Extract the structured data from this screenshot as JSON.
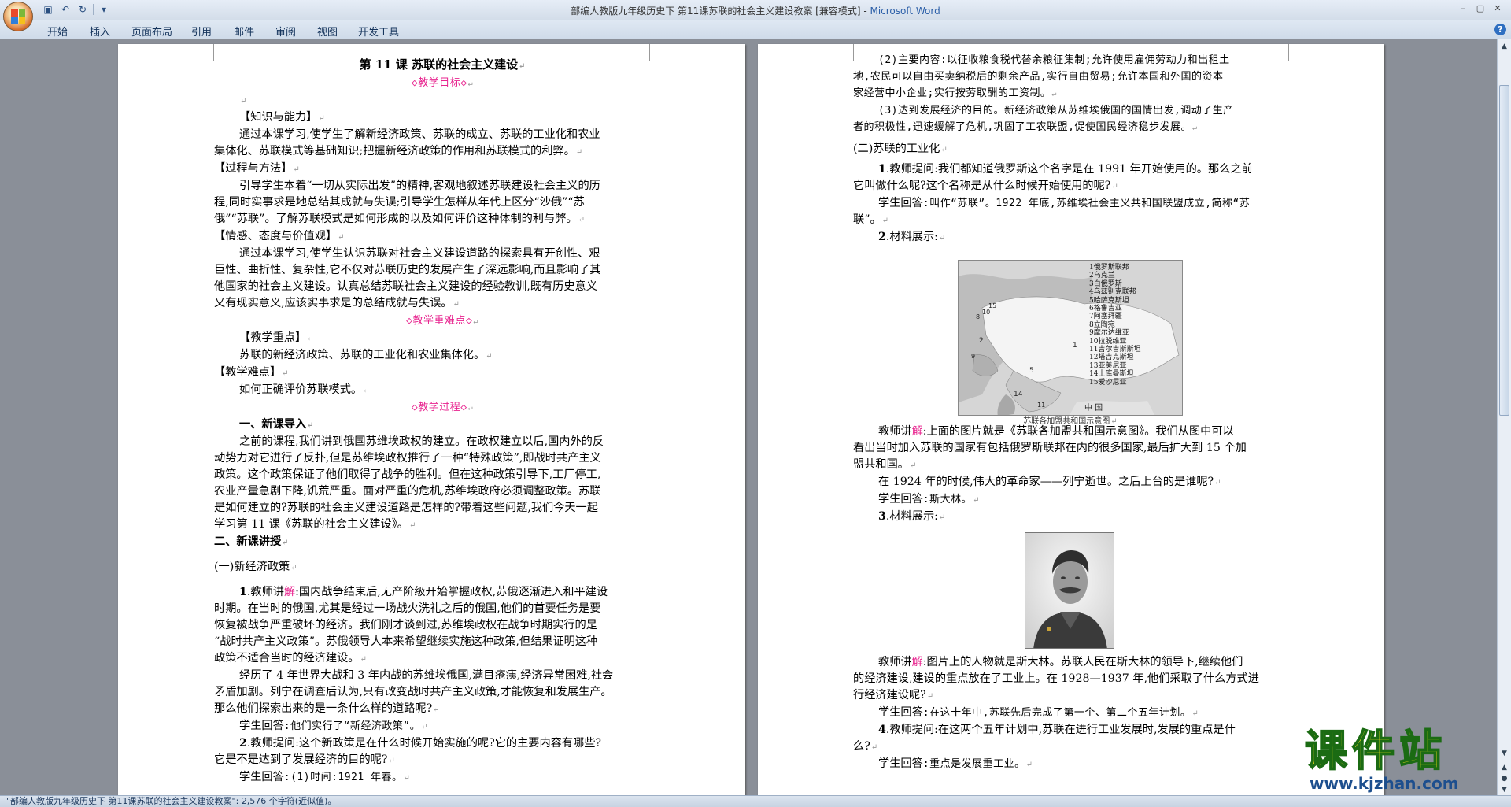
{
  "window": {
    "title": "部编人教版九年级历史下  第11课苏联的社会主义建设教案 [兼容模式] - ",
    "app_name": "Microsoft Word",
    "controls": [
      "–",
      "▢",
      "✕"
    ]
  },
  "ribbon": {
    "tabs": [
      "开始",
      "插入",
      "页面布局",
      "引用",
      "邮件",
      "审阅",
      "视图",
      "开发工具"
    ]
  },
  "page1": {
    "title": "第 11 课    苏联的社会主义建设",
    "sec_goal": "◇教学目标◇",
    "p_kn_head": "【知识与能力】",
    "p_kn_1": "通过本课学习,使学生了解新经济政策、苏联的成立、苏联的工业化和农业",
    "p_kn_2": "集体化、苏联模式等基础知识;把握新经济政策的作用和苏联模式的利弊。",
    "p_pr_head": "【过程与方法】",
    "p_pr_1": "引导学生本着“一切从实际出发”的精神,客观地叙述苏联建设社会主义的历",
    "p_pr_2": "程,同时实事求是地总结其成就与失误;引导学生怎样从年代上区分“沙俄”“苏",
    "p_pr_3": "俄”“苏联”。了解苏联模式是如何形成的以及如何评价这种体制的利与弊。",
    "p_em_head": "【情感、态度与价值观】",
    "p_em_1": "通过本课学习,使学生认识苏联对社会主义建设道路的探索具有开创性、艰",
    "p_em_2": "巨性、曲折性、复杂性,它不仅对苏联历史的发展产生了深远影响,而且影响了其",
    "p_em_3": "他国家的社会主义建设。认真总结苏联社会主义建设的经验教训,既有历史意义",
    "p_em_4": "又有现实意义,应该实事求是的总结成就与失误。",
    "sec_key": "◇教学重难点◇",
    "p_key_head": "【教学重点】",
    "p_key_1": "苏联的新经济政策、苏联的工业化和农业集体化。",
    "p_diff_head": "【教学难点】",
    "p_diff_1": "如何正确评价苏联模式。",
    "sec_proc": "◇教学过程◇",
    "h_intro": "一、新课导入",
    "p_in_1": "之前的课程,我们讲到俄国苏维埃政权的建立。在政权建立以后,国内外的反",
    "p_in_2": "动势力对它进行了反扑,但是苏维埃政权推行了一种“特殊政策”,即战时共产主义",
    "p_in_3": "政策。这个政策保证了他们取得了战争的胜利。但在这种政策引导下,工厂停工,",
    "p_in_4": "农业产量急剧下降,饥荒严重。面对严重的危机,苏维埃政府必须调整政策。苏联",
    "p_in_5": "是如何建立的?苏联的社会主义建设道路是怎样的?带着这些问题,我们今天一起",
    "p_in_6": "学习第 11 课《苏联的社会主义建设》。",
    "h_teach": "二、新课讲授",
    "h_nep": "(一)新经济政策",
    "p_n1_a": "1",
    "p_n1_b": ".教师讲",
    "p_n1_c": "解",
    "p_n1_d": ":国内战争结束后,无产阶级开始掌握政权,苏俄逐渐进入和平建设",
    "p_n1_2": "时期。在当时的俄国,尤其是经过一场战火洗礼之后的俄国,他们的首要任务是要",
    "p_n1_3": "恢复被战争严重破坏的经济。我们刚才谈到过,苏维埃政权在战争时期实行的是",
    "p_n1_4": "“战时共产主义政策”。苏俄领导人本来希望继续实施这种政策,但结果证明这种",
    "p_n1_5": "政策不适合当时的经济建设。",
    "p_n2_1": "经历了 4 年世界大战和 3 年内战的苏维埃俄国,满目疮痍,经济异常困难,社会",
    "p_n2_2": "矛盾加剧。列宁在调查后认为,只有改变战时共产主义政策,才能恢复和发展生产。",
    "p_n2_3": "那么他们探索出来的是一条什么样的道路呢?",
    "p_s1_a": "学生回答",
    "p_s1_b": ":他们实行了“新经济政策”。",
    "p_q2_a": "2",
    "p_q2_b": ".教师提问:这个新政策是在什么时候开始实施的呢?它的主要内容有哪些?",
    "p_q2_2": "它是不是达到了发展经济的目的呢?",
    "p_s2_a": "学生回答",
    "p_s2_b": ":(1)时间:1921 年春。"
  },
  "page2": {
    "p_c2_1": "(2)主要内容:以征收粮食税代替余粮征集制;允许使用雇佣劳动力和出租土",
    "p_c2_2": "地,农民可以自由买卖纳税后的剩余产品,实行自由贸易;允许本国和外国的资本",
    "p_c2_3": "家经营中小企业;实行按劳取酬的工资制。",
    "p_c3_1": "(3)达到发展经济的目的。新经济政策从苏维埃俄国的国情出发,调动了生产",
    "p_c3_2": "者的积极性,迅速缓解了危机,巩固了工农联盟,促使国民经济稳步发展。",
    "h_ind": "(二)苏联的工业化",
    "p_q1_a": "1",
    "p_q1_b": ".教师提问:我们都知道俄罗斯这个名字是在 1991 年开始使用的。那么之前",
    "p_q1_2": "它叫做什么呢?这个名称是从什么时候开始使用的呢?",
    "p_s1_a": "学生回答",
    "p_s1_b": ":叫作“苏联”。1922 年底,苏维埃社会主义共和国联盟成立,简称“苏",
    "p_s1_2": "联”。",
    "p_m2_a": "2",
    "p_m2_b": ".材料展示:",
    "map": {
      "legend": [
        "1俄罗斯联邦",
        "2乌克兰",
        "3白俄罗斯",
        "4乌兹别克联邦",
        "5哈萨克斯坦",
        "6格鲁吉亚",
        "7阿塞拜疆",
        "8立陶宛",
        "9摩尔达维亚",
        "10拉脱维亚",
        "11吉尔吉斯斯坦",
        "12塔吉克斯坦",
        "13亚美尼亚",
        "14土库曼斯坦",
        "15爱沙尼亚"
      ],
      "numbers": [
        "1",
        "2",
        "5",
        "14",
        "10",
        "15",
        "8",
        "9",
        "11"
      ],
      "china_label": "中   国",
      "caption": "苏联各加盟共和国示意图"
    },
    "p_e1_a": "教师讲",
    "p_e1_b": "解",
    "p_e1_c": ":上面的图片就是《苏联各加盟共和国示意图》。我们从图中可以",
    "p_e1_2": "看出当时加入苏联的国家有包括俄罗斯联邦在内的很多国家,最后扩大到 15 个加",
    "p_e1_3": "盟共和国。",
    "p_e2_1": "在 1924 年的时候,伟大的革命家——列宁逝世。之后上台的是谁呢?",
    "p_s2_a": "学生回答",
    "p_s2_b": ":斯大林。",
    "p_m3_a": "3",
    "p_m3_b": ".材料展示:",
    "p_e3_a": "教师讲",
    "p_e3_b": "解",
    "p_e3_c": ":图片上的人物就是斯大林。苏联人民在斯大林的领导下,继续他们",
    "p_e3_2": "的经济建设,建设的重点放在了工业上。在 1928—1937 年,他们采取了什么方式进",
    "p_e3_3": "行经济建设呢?",
    "p_s3_a": "学生回答",
    "p_s3_b": ":在这十年中,苏联先后完成了第一个、第二个五年计划。",
    "p_q4_a": "4",
    "p_q4_b": ".教师提问:在这两个五年计划中,苏联在进行工业发展时,发展的重点是什",
    "p_q4_2": "么?",
    "p_s4_a": "学生回答",
    "p_s4_b": ":重点是发展重工业。"
  },
  "status": {
    "text": "\"部编人教版九年级历史下  第11课苏联的社会主义建设教案\": 2,576 个字符(近似值)。"
  },
  "watermark": {
    "text": "课件站",
    "url": "www.kjzhan.com"
  },
  "colors": {
    "highlight_pink": "#e8248f",
    "watermark_yellow": "#f4e21a",
    "watermark_green": "#1b6b13"
  }
}
